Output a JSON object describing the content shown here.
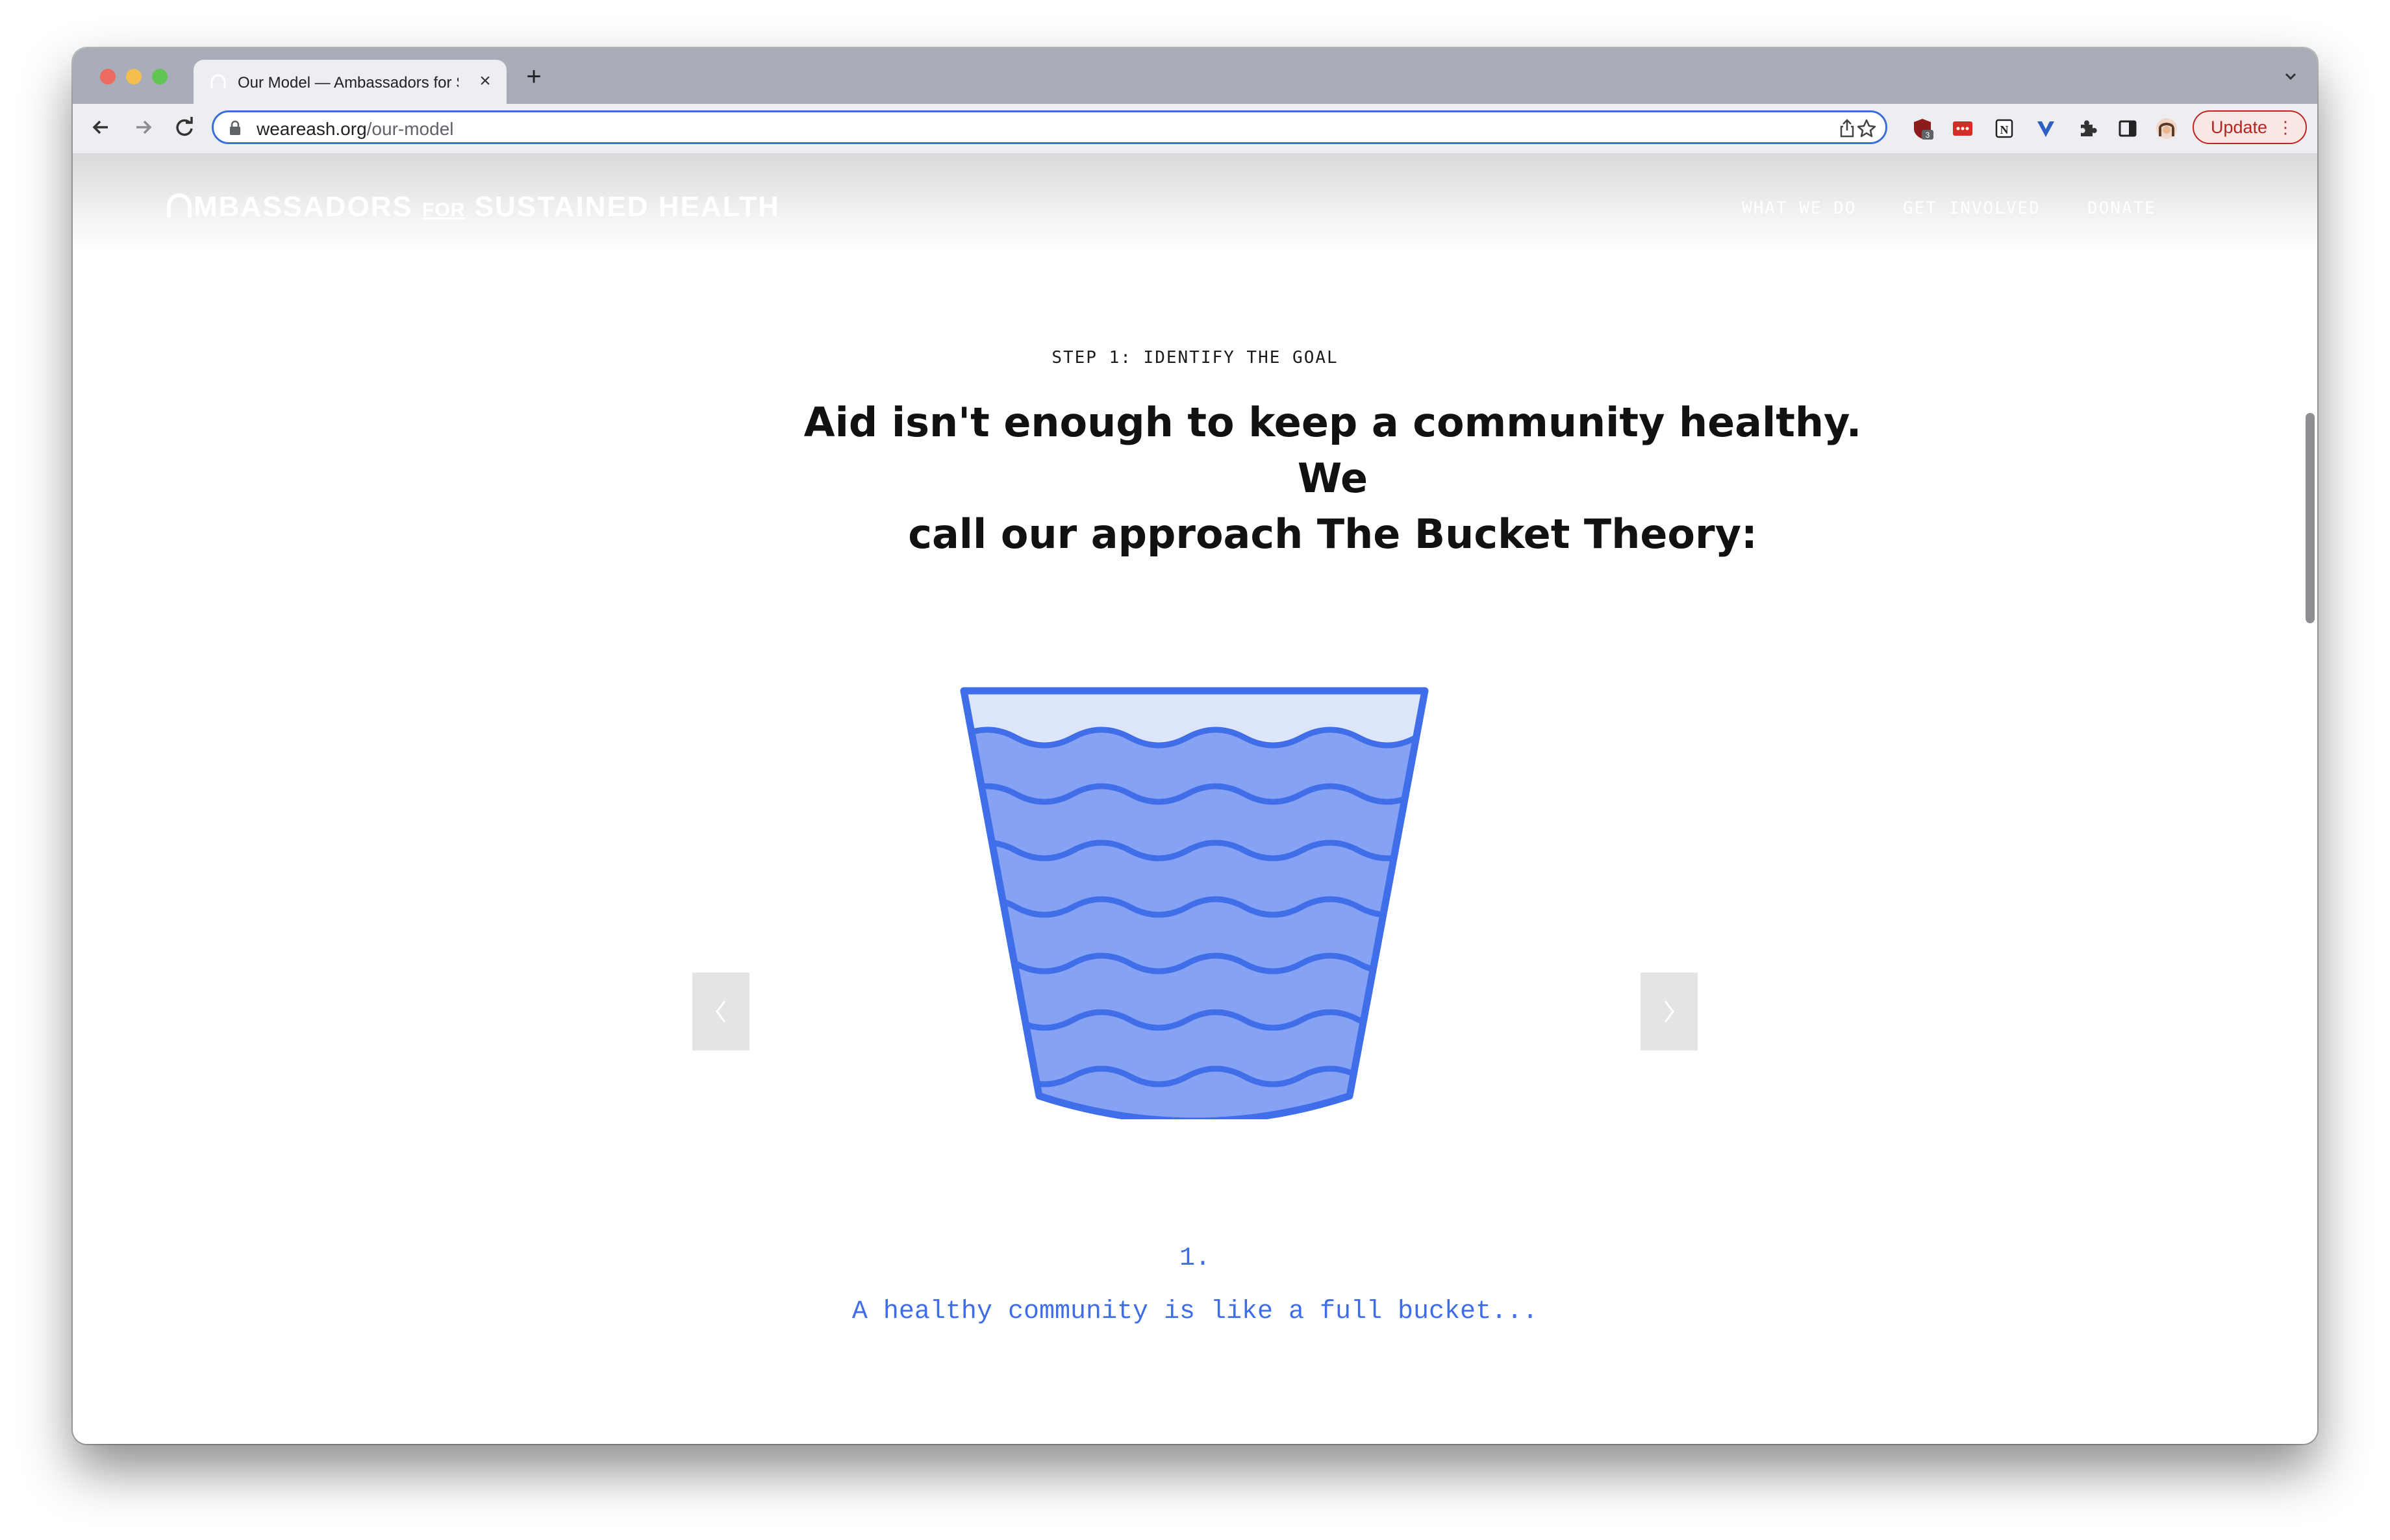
{
  "browser": {
    "tab_title": "Our Model — Ambassadors for Sustained Health",
    "tab_close": "×",
    "new_tab": "+",
    "url_host": "weareash.org",
    "url_path": "/our-model",
    "update_label": "Update",
    "update_menu": "⋮",
    "extension_badge": "3",
    "extension_n_label": "N"
  },
  "site": {
    "logo_part1": "MBASSADORS",
    "logo_for": "FOR",
    "logo_part2": "SUSTAINED HEALTH",
    "nav": [
      "WHAT WE DO",
      "GET INVOLVED",
      "DONATE"
    ]
  },
  "content": {
    "eyebrow": "STEP 1: IDENTIFY THE GOAL",
    "headline_line1": "Aid isn't enough to keep a community healthy. We",
    "headline_line2": "call our approach The Bucket Theory:",
    "slide_number": "1.",
    "slide_caption": "A healthy community is like a full bucket..."
  },
  "colors": {
    "accent_blue": "#3f6ee8",
    "bucket_fill": "#86a2f5",
    "bucket_top": "#dde5fb",
    "update_red": "#c5221f"
  },
  "icons": [
    "back-arrow-icon",
    "forward-arrow-icon",
    "reload-icon",
    "lock-icon",
    "share-icon",
    "star-icon",
    "puzzle-icon",
    "sidepanel-icon",
    "chevron-left-icon",
    "chevron-right-icon"
  ]
}
